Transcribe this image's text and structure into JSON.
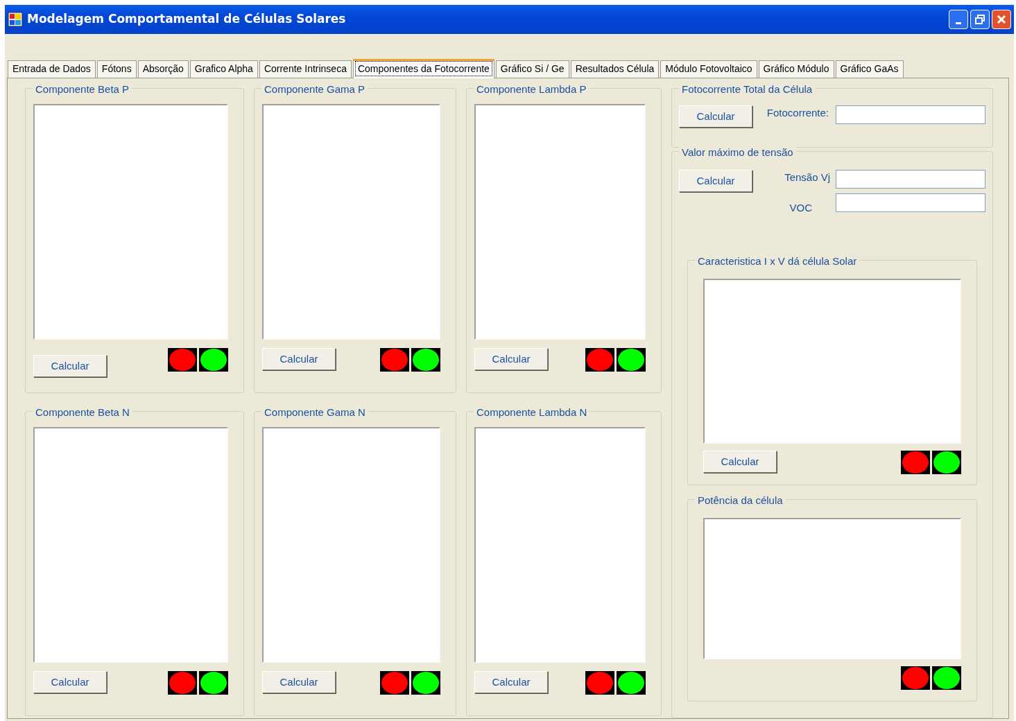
{
  "window": {
    "title": "Modelagem Comportamental de Células Solares"
  },
  "tabs": [
    {
      "label": "Entrada de Dados",
      "selected": false
    },
    {
      "label": "Fótons",
      "selected": false
    },
    {
      "label": "Absorção",
      "selected": false
    },
    {
      "label": "Grafico Alpha",
      "selected": false
    },
    {
      "label": "Corrente Intrinseca",
      "selected": false
    },
    {
      "label": "Componentes da Fotocorrente",
      "selected": true
    },
    {
      "label": "Gráfico Si / Ge",
      "selected": false
    },
    {
      "label": "Resultados Célula",
      "selected": false
    },
    {
      "label": "Módulo Fotovoltaico",
      "selected": false
    },
    {
      "label": "Gráfico Módulo",
      "selected": false
    },
    {
      "label": "Gráfico GaAs",
      "selected": false
    }
  ],
  "components": [
    {
      "title": "Componente Beta P",
      "button": "Calcular",
      "lights": [
        {
          "color": "#ff0000"
        },
        {
          "color": "#00ff00"
        }
      ]
    },
    {
      "title": "Componente Gama P",
      "button": "Calcular",
      "lights": [
        {
          "color": "#ff0000"
        },
        {
          "color": "#00ff00"
        }
      ]
    },
    {
      "title": "Componente Lambda P",
      "button": "Calcular",
      "lights": [
        {
          "color": "#ff0000"
        },
        {
          "color": "#00ff00"
        }
      ]
    },
    {
      "title": "Componente Beta N",
      "button": "Calcular",
      "lights": [
        {
          "color": "#ff0000"
        },
        {
          "color": "#00ff00"
        }
      ]
    },
    {
      "title": "Componente Gama N",
      "button": "Calcular",
      "lights": [
        {
          "color": "#ff0000"
        },
        {
          "color": "#00ff00"
        }
      ]
    },
    {
      "title": "Componente Lambda N",
      "button": "Calcular",
      "lights": [
        {
          "color": "#ff0000"
        },
        {
          "color": "#00ff00"
        }
      ]
    }
  ],
  "total": {
    "title": "Fotocorrente Total da Célula",
    "button": "Calcular",
    "field_label": "Fotocorrente:"
  },
  "tension": {
    "title": "Valor máximo de tensão",
    "button": "Calcular",
    "fields": [
      {
        "label": "Tensão Vj"
      },
      {
        "label": "VOC"
      }
    ],
    "charts": [
      {
        "title": "Caracteristica I x V dá célula Solar",
        "button": "Calcular",
        "lights": [
          {
            "color": "#ff0000"
          },
          {
            "color": "#00ff00"
          }
        ]
      },
      {
        "title": "Potência da célula",
        "lights": [
          {
            "color": "#ff0000"
          },
          {
            "color": "#00ff00"
          }
        ]
      }
    ]
  }
}
